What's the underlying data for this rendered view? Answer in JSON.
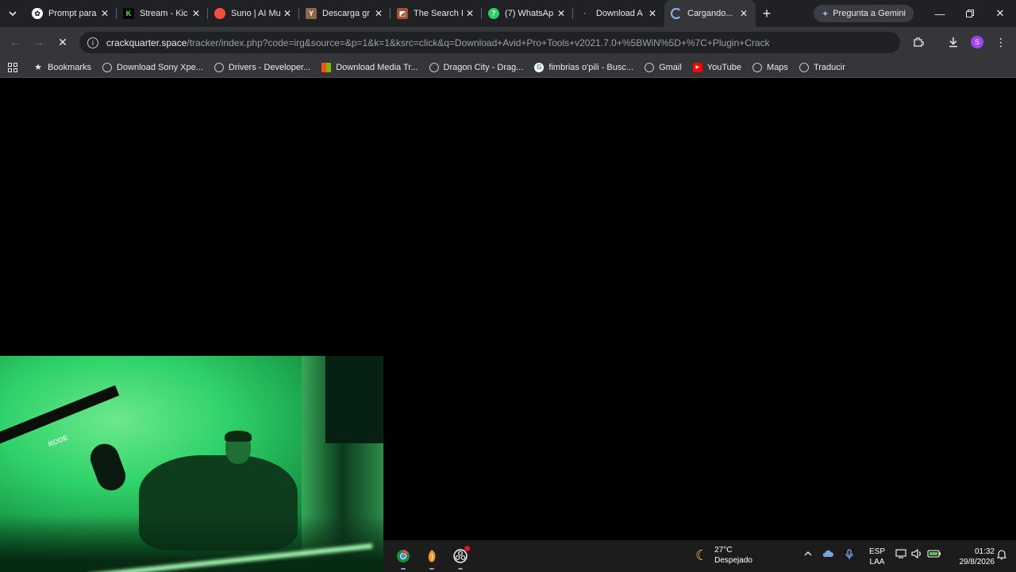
{
  "tabs": [
    {
      "title": "Prompt para",
      "favicon": "openai-icon",
      "color": "#ffffff",
      "active": false
    },
    {
      "title": "Stream - Kic",
      "favicon": "kick-icon",
      "color": "#53fc18",
      "active": false
    },
    {
      "title": "Suno | AI Mu",
      "favicon": "suno-icon",
      "color": "#f0503c",
      "active": false
    },
    {
      "title": "Descarga gr",
      "favicon": "y-icon",
      "color": "#c0a070",
      "active": false
    },
    {
      "title": "The Search I",
      "favicon": "search-site-icon",
      "color": "#a0522d",
      "active": false
    },
    {
      "title": "(7) WhatsAp",
      "favicon": "whatsapp-icon",
      "color": "#25d366",
      "active": false
    },
    {
      "title": "Download A",
      "favicon": "dot-icon",
      "color": "#5f6368",
      "active": false
    },
    {
      "title": "Cargando...",
      "favicon": "loading-icon",
      "color": "#8ab4f8",
      "active": true
    }
  ],
  "tab_close_glyph": "✕",
  "new_tab_glyph": "+",
  "gemini_label": "Pregunta a Gemini",
  "address": {
    "host": "crackquarter.space",
    "path": "/tracker/index.php?code=irg&source=&p=1&k=1&ksrc=click&q=Download+Avid+Pro+Tools+v2021.7.0+%5BWiN%5D+%7C+Plugin+Crack"
  },
  "profile_initial": "S",
  "bookmarks": [
    {
      "label": "Bookmarks",
      "icon": "star-icon"
    },
    {
      "label": "Download Sony Xpe...",
      "icon": "globe-icon"
    },
    {
      "label": "Drivers - Developer...",
      "icon": "globe-icon"
    },
    {
      "label": "Download Media Tr...",
      "icon": "microsoft-icon"
    },
    {
      "label": "Dragon City - Drag...",
      "icon": "globe-icon"
    },
    {
      "label": "fimbrias o'pili - Busc...",
      "icon": "google-icon"
    },
    {
      "label": "Gmail",
      "icon": "globe-icon"
    },
    {
      "label": "YouTube",
      "icon": "youtube-icon"
    },
    {
      "label": "Maps",
      "icon": "globe-icon"
    },
    {
      "label": "Traducir",
      "icon": "globe-icon"
    }
  ],
  "webcam": {
    "mic_brand": "RODE"
  },
  "taskbar": {
    "weather_temp": "27°C",
    "weather_desc": "Despejado",
    "lang_top": "ESP",
    "lang_bottom": "LAA",
    "time": "01:32",
    "date": "29/8/2026"
  },
  "colors": {
    "tabstrip": "#202124",
    "toolbar": "#35363a",
    "accent": "#8ab4f8",
    "webcam_green": "#2fd26a"
  }
}
